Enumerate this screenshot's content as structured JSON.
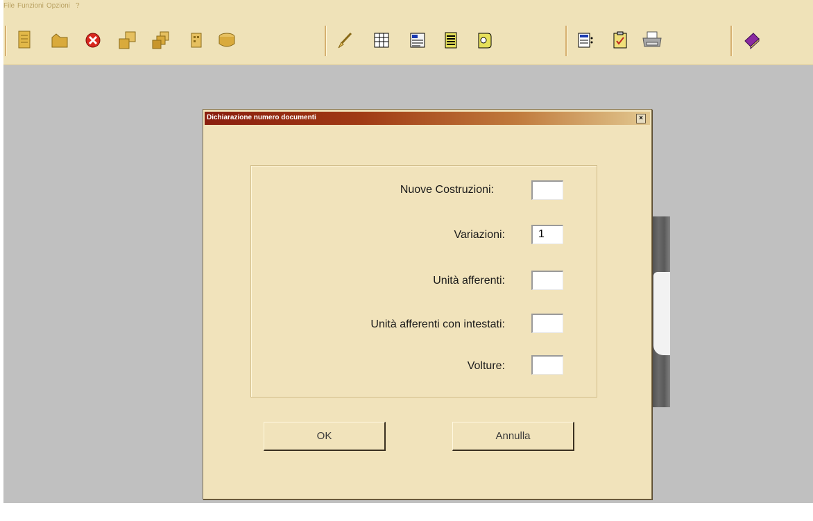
{
  "menu": [
    "File",
    "Funzioni",
    "Opzioni",
    "?"
  ],
  "toolbar_icons": [
    "new-document-icon",
    "folder-icon",
    "delete-icon",
    "copy-icon",
    "multi-copy-icon",
    "building-icon",
    "stack-icon",
    "brush-icon",
    "grid-icon",
    "form-icon",
    "list-icon",
    "wizard-icon",
    "table-icon",
    "checklist-icon",
    "printer-icon",
    "help-book-icon"
  ],
  "dialog": {
    "title": "Dichiarazione numero documenti",
    "close_label": "×",
    "fields": [
      {
        "label": "Nuove Costruzioni:",
        "value": ""
      },
      {
        "label": "Variazioni:",
        "value": "1"
      },
      {
        "label": "Unità afferenti:",
        "value": ""
      },
      {
        "label": "Unità afferenti con intestati:",
        "value": ""
      },
      {
        "label": "Volture:",
        "value": ""
      }
    ],
    "ok_label": "OK",
    "cancel_label": "Annulla"
  },
  "colors": {
    "panel": "#f1e3bb",
    "title_start": "#8a1e0e",
    "title_end": "#e2c890",
    "background": "#c0c0c0"
  }
}
